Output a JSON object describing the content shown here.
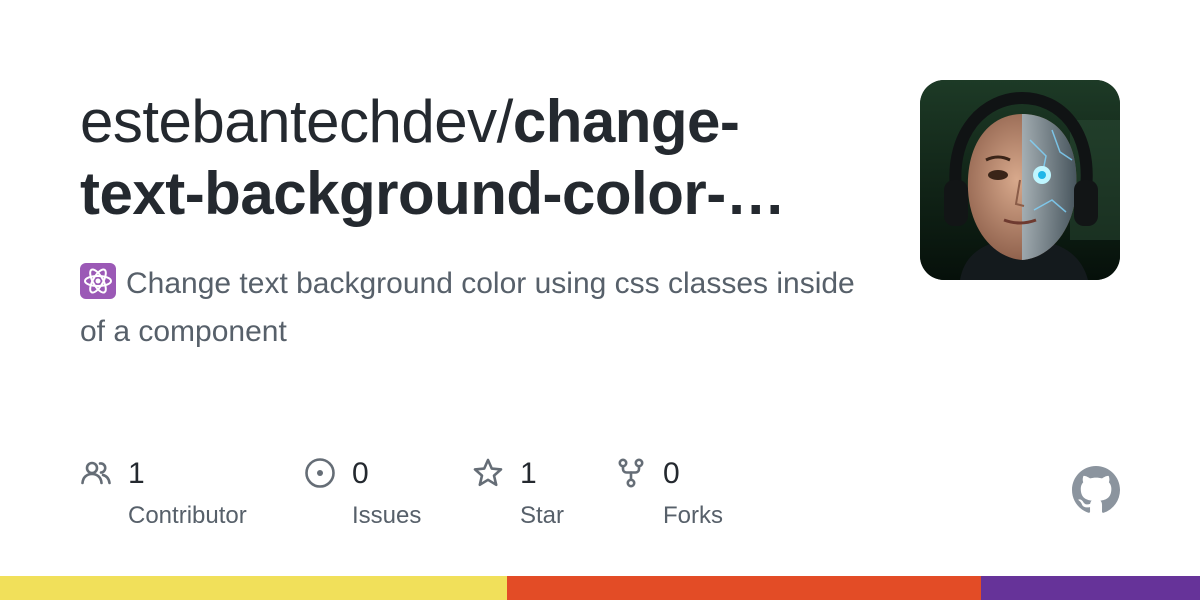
{
  "repo": {
    "owner": "estebantechdev/",
    "name": "change-text-background-color-…",
    "description": "Change text background color using css classes inside of a component",
    "description_emoji": "atom-icon"
  },
  "stats": [
    {
      "icon": "people-icon",
      "value": "1",
      "label": "Contributor"
    },
    {
      "icon": "issue-icon",
      "value": "0",
      "label": "Issues"
    },
    {
      "icon": "star-icon",
      "value": "1",
      "label": "Star"
    },
    {
      "icon": "fork-icon",
      "value": "0",
      "label": "Forks"
    }
  ],
  "colors": {
    "title": "#24292f",
    "muted": "#57606a",
    "icon": "#656d76",
    "logo": "#8b949e"
  },
  "language_bar": [
    {
      "color": "#f1e05a",
      "share": 0.4225
    },
    {
      "color": "#e34c26",
      "share": 0.395
    },
    {
      "color": "#663399",
      "share": 0.1825
    }
  ]
}
